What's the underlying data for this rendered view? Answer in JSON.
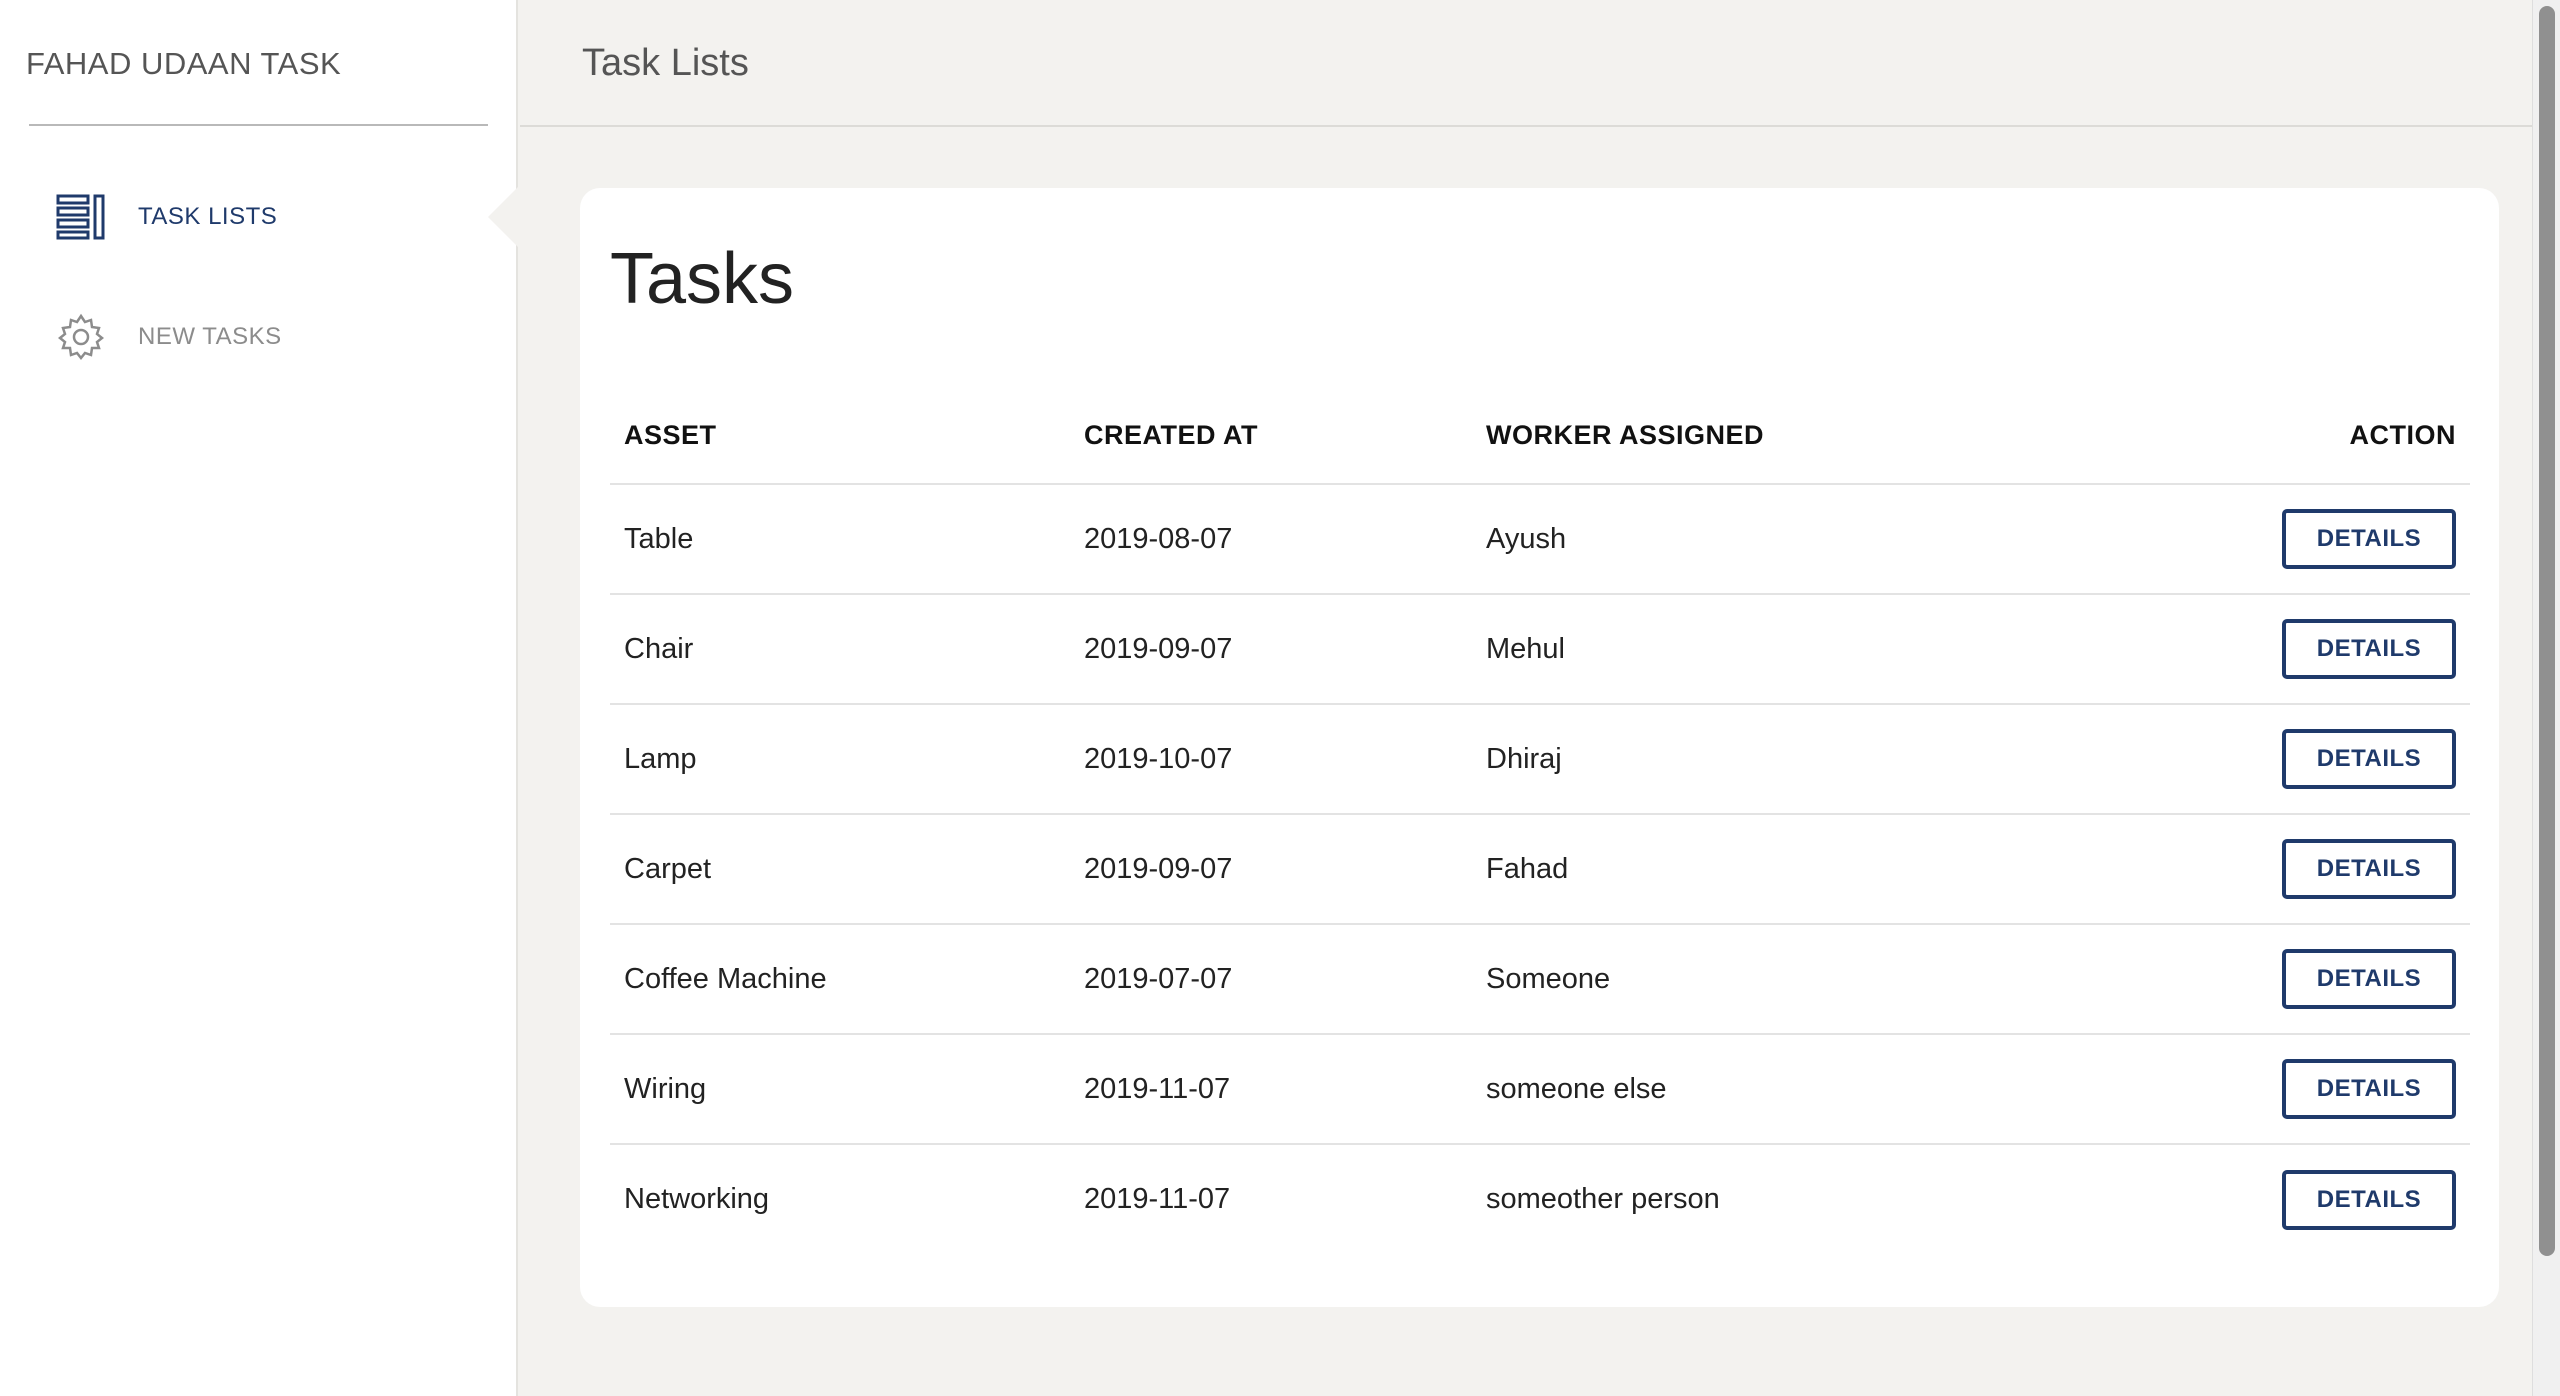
{
  "sidebar": {
    "brand": "FAHAD UDAAN TASK",
    "items": [
      {
        "label": "TASK LISTS",
        "icon": "list-icon",
        "active": true
      },
      {
        "label": "NEW TASKS",
        "icon": "gear-icon",
        "active": false
      }
    ]
  },
  "header": {
    "title": "Task Lists"
  },
  "main": {
    "card_title": "Tasks",
    "columns": [
      "ASSET",
      "CREATED AT",
      "WORKER ASSIGNED",
      "ACTION"
    ],
    "rows": [
      {
        "asset": "Table",
        "created_at": "2019-08-07",
        "worker": "Ayush",
        "action": "DETAILS"
      },
      {
        "asset": "Chair",
        "created_at": "2019-09-07",
        "worker": "Mehul",
        "action": "DETAILS"
      },
      {
        "asset": "Lamp",
        "created_at": "2019-10-07",
        "worker": "Dhiraj",
        "action": "DETAILS"
      },
      {
        "asset": "Carpet",
        "created_at": "2019-09-07",
        "worker": "Fahad",
        "action": "DETAILS"
      },
      {
        "asset": "Coffee Machine",
        "created_at": "2019-07-07",
        "worker": "Someone",
        "action": "DETAILS"
      },
      {
        "asset": "Wiring",
        "created_at": "2019-11-07",
        "worker": "someone else",
        "action": "DETAILS"
      },
      {
        "asset": "Networking",
        "created_at": "2019-11-07",
        "worker": "someother person",
        "action": "DETAILS"
      }
    ]
  },
  "colors": {
    "accent": "#1f3a6b",
    "background": "#f3f2ef",
    "card": "#ffffff"
  }
}
